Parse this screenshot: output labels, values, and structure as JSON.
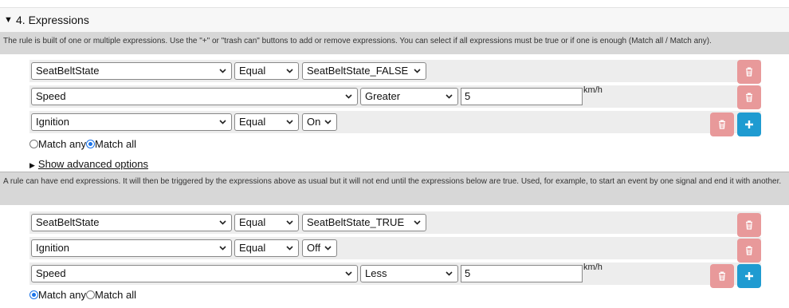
{
  "section": {
    "toggle_icon": "triangle-down-icon",
    "title": "4. Expressions"
  },
  "description": "The rule is built of one or multiple expressions. Use the \"+\" or \"trash can\" buttons to add or remove expressions. You can select if all expressions must be true or if one is enough (Match all / Match any).",
  "expressions": [
    {
      "signal": "SeatBeltState",
      "operator": "Equal",
      "value": "SeatBeltState_FALSE"
    },
    {
      "signal": "Speed",
      "operator": "Greater",
      "value": "5",
      "unit": "km/h"
    },
    {
      "signal": "Ignition",
      "operator": "Equal",
      "value": "On"
    }
  ],
  "match": {
    "any_label": "Match any",
    "all_label": "Match all",
    "selected": "all"
  },
  "advanced_toggle": {
    "icon": "triangle-right-icon",
    "label": "Show advanced options"
  },
  "end_description": "A rule can have end expressions. It will then be triggered by the expressions above as usual but it will not end until the expressions below are true. Used, for example, to start an event by one signal and end it with another.",
  "end_expressions": [
    {
      "signal": "SeatBeltState",
      "operator": "Equal",
      "value": "SeatBeltState_TRUE"
    },
    {
      "signal": "Ignition",
      "operator": "Equal",
      "value": "Off"
    },
    {
      "signal": "Speed",
      "operator": "Less",
      "value": "5",
      "unit": "km/h"
    }
  ],
  "end_match": {
    "any_label": "Match any",
    "all_label": "Match all",
    "selected": "any"
  },
  "colors": {
    "delete_button": "#e8999a",
    "add_button": "#1f9bd1",
    "description_bg": "#d7d7d7",
    "row_bg": "#ededed"
  },
  "icons": {
    "delete": "trash-icon",
    "add": "plus-icon",
    "dropdown": "chevron-down-icon"
  }
}
